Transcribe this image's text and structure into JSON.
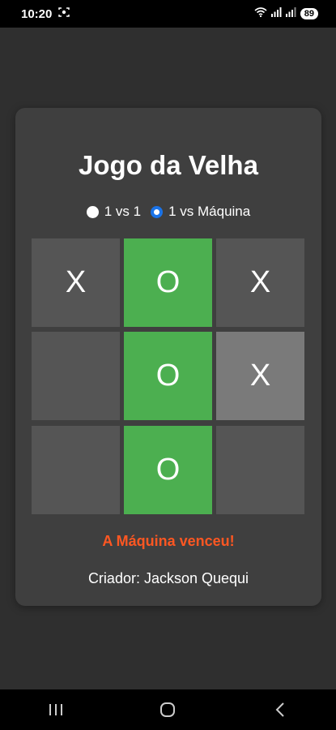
{
  "status_bar": {
    "time": "10:20",
    "battery": "89"
  },
  "game": {
    "title": "Jogo da Velha",
    "modes": [
      {
        "label": "1 vs 1",
        "selected": false
      },
      {
        "label": "1 vs Máquina",
        "selected": true
      }
    ],
    "board": [
      "X",
      "O",
      "X",
      "",
      "O",
      "X",
      "",
      "O",
      ""
    ],
    "winning_cells": [
      1,
      4,
      7
    ],
    "win_color": "#4caf50",
    "result": "A Máquina venceu!",
    "result_color": "#ff5722",
    "creator": "Criador: Jackson Quequi"
  },
  "nav": {
    "buttons": [
      "recent-apps",
      "home",
      "back"
    ]
  }
}
